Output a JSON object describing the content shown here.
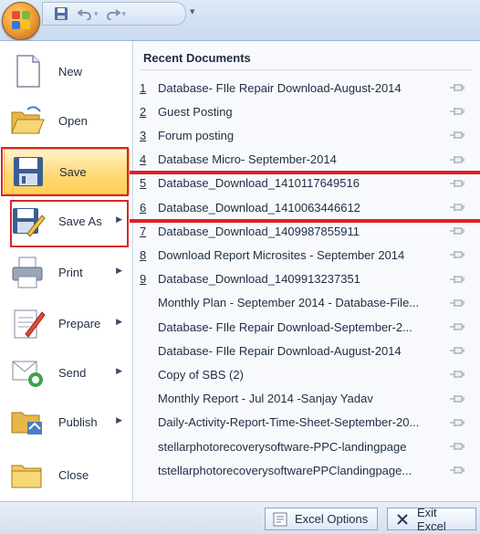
{
  "qat": {
    "save_tooltip": "Save",
    "undo_tooltip": "Undo",
    "redo_tooltip": "Redo"
  },
  "left_menu": {
    "items": [
      {
        "label": "New",
        "icon": "new-document-icon",
        "has_submenu": false
      },
      {
        "label": "Open",
        "icon": "open-folder-icon",
        "has_submenu": false
      },
      {
        "label": "Save",
        "icon": "save-disk-icon",
        "has_submenu": false
      },
      {
        "label": "Save As",
        "icon": "save-as-icon",
        "has_submenu": true
      },
      {
        "label": "Print",
        "icon": "printer-icon",
        "has_submenu": true
      },
      {
        "label": "Prepare",
        "icon": "prepare-icon",
        "has_submenu": true
      },
      {
        "label": "Send",
        "icon": "send-icon",
        "has_submenu": true
      },
      {
        "label": "Publish",
        "icon": "publish-icon",
        "has_submenu": true
      },
      {
        "label": "Close",
        "icon": "close-folder-icon",
        "has_submenu": false
      }
    ]
  },
  "recent": {
    "title": "Recent Documents",
    "items": [
      {
        "num": "1",
        "name": "Database- FIle Repair Download-August-2014"
      },
      {
        "num": "2",
        "name": "Guest Posting"
      },
      {
        "num": "3",
        "name": "Forum posting"
      },
      {
        "num": "4",
        "name": "Database Micro- September-2014"
      },
      {
        "num": "5",
        "name": "Database_Download_1410117649516"
      },
      {
        "num": "6",
        "name": "Database_Download_1410063446612"
      },
      {
        "num": "7",
        "name": "Database_Download_1409987855911"
      },
      {
        "num": "8",
        "name": "Download Report Microsites - September 2014"
      },
      {
        "num": "9",
        "name": "Database_Download_1409913237351"
      },
      {
        "num": "",
        "name": "Monthly Plan - September 2014 - Database-File..."
      },
      {
        "num": "",
        "name": "Database- FIle Repair Download-September-2..."
      },
      {
        "num": "",
        "name": "Database- FIle Repair Download-August-2014"
      },
      {
        "num": "",
        "name": "Copy of SBS (2)"
      },
      {
        "num": "",
        "name": "Monthly Report - Jul 2014 -Sanjay Yadav"
      },
      {
        "num": "",
        "name": "Daily-Activity-Report-Time-Sheet-September-20..."
      },
      {
        "num": "",
        "name": "stellarphotorecoverysoftware-PPC-landingpage"
      },
      {
        "num": "",
        "name": "tstellarphotorecoverysoftwarePPClandingpage..."
      }
    ]
  },
  "bottom": {
    "options_label": "Excel Options",
    "exit_label": "Exit Excel"
  },
  "colors": {
    "highlight_red": "#e01f26",
    "save_highlight": "#ffd978",
    "frame": "#c9daef"
  }
}
